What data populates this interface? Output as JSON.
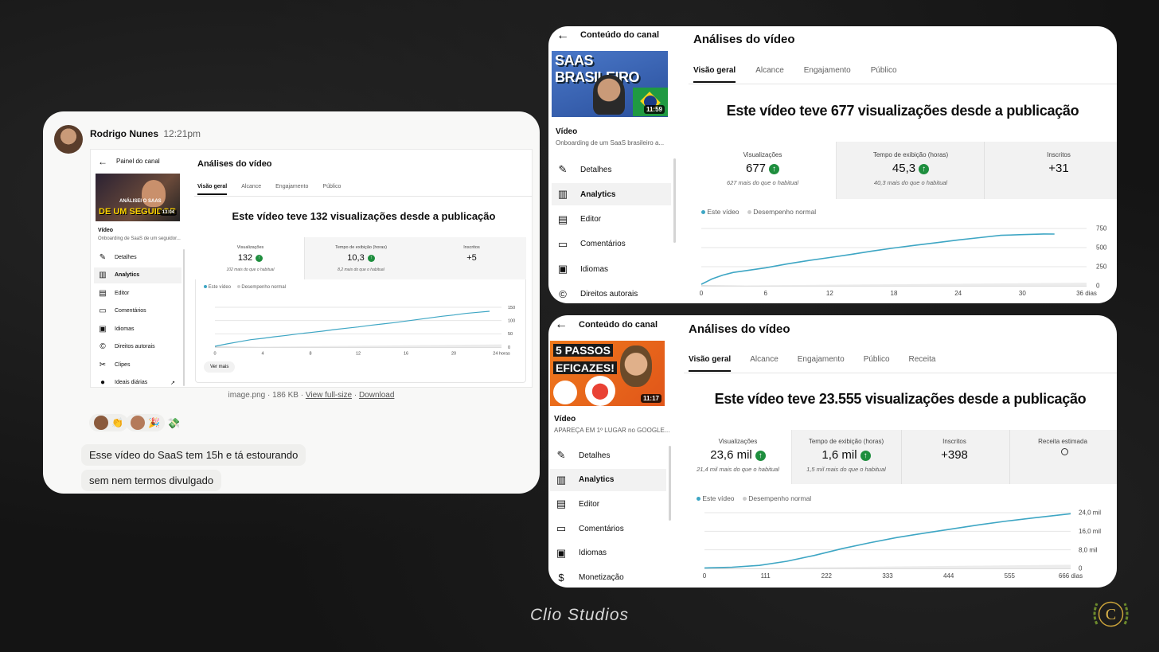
{
  "chat": {
    "author": "Rodrigo Nunes",
    "time": "12:21pm",
    "attachment": {
      "name": "image.png",
      "size": "186 KB",
      "view_label": "View full-size",
      "download_label": "Download",
      "separator": "·"
    },
    "messages": [
      "Esse vídeo do SaaS tem 15h e tá estourando",
      "sem nem termos divulgado"
    ],
    "reactions": [
      "👏",
      "🎉",
      "💸"
    ],
    "embed": {
      "back_label": "Painel do canal",
      "page_title": "Análises do vídeo",
      "tabs": [
        "Visão geral",
        "Alcance",
        "Engajamento",
        "Público"
      ],
      "thumb": {
        "text_small": "ANÁLISEI O SAAS",
        "text_big": "DE UM SEGUIDOR",
        "duration": "13:04"
      },
      "video_label": "Vídeo",
      "video_title": "Onboarding de SaaS de um seguidor...",
      "nav": [
        {
          "icon": "pencil-icon",
          "label": "Detalhes"
        },
        {
          "icon": "analytics-icon",
          "label": "Analytics"
        },
        {
          "icon": "editor-icon",
          "label": "Editor"
        },
        {
          "icon": "comments-icon",
          "label": "Comentários"
        },
        {
          "icon": "subtitles-icon",
          "label": "Idiomas"
        },
        {
          "icon": "copyright-icon",
          "label": "Direitos autorais"
        },
        {
          "icon": "scissors-icon",
          "label": "Clipes"
        },
        {
          "icon": "lightbulb-icon",
          "label": "Ideais diárias"
        }
      ],
      "headline": "Este vídeo teve 132 visualizações desde a publicação",
      "metrics": [
        {
          "label": "Visualizações",
          "value": "132",
          "up": true,
          "note": "102 mais do que o habitual"
        },
        {
          "label": "Tempo de exibição (horas)",
          "value": "10,3",
          "up": true,
          "note": "8,2 mais do que o habitual"
        },
        {
          "label": "Inscritos",
          "value": "+5",
          "up": false,
          "note": ""
        }
      ],
      "legend": [
        "Este vídeo",
        "Desempenho normal"
      ],
      "see_more": "Ver mais"
    }
  },
  "yt1": {
    "back_label": "Conteúdo do canal",
    "page_title": "Análises do vídeo",
    "tabs": [
      "Visão geral",
      "Alcance",
      "Engajamento",
      "Público"
    ],
    "thumb": {
      "text": "SAAS BRASILEIRO",
      "duration": "11:59"
    },
    "video_label": "Vídeo",
    "video_title": "Onboarding de um SaaS brasileiro a...",
    "nav": [
      {
        "icon": "pencil-icon",
        "label": "Detalhes"
      },
      {
        "icon": "analytics-icon",
        "label": "Analytics"
      },
      {
        "icon": "editor-icon",
        "label": "Editor"
      },
      {
        "icon": "comments-icon",
        "label": "Comentários"
      },
      {
        "icon": "subtitles-icon",
        "label": "Idiomas"
      },
      {
        "icon": "copyright-icon",
        "label": "Direitos autorais"
      }
    ],
    "headline": "Este vídeo teve 677 visualizações desde a publicação",
    "metrics": [
      {
        "label": "Visualizações",
        "value": "677",
        "up": true,
        "note": "627 mais do que o habitual"
      },
      {
        "label": "Tempo de exibição (horas)",
        "value": "45,3",
        "up": true,
        "note": "40,3 mais do que o habitual"
      },
      {
        "label": "Inscritos",
        "value": "+31",
        "up": false,
        "note": ""
      }
    ],
    "legend": [
      "Este vídeo",
      "Desempenho normal"
    ]
  },
  "yt2": {
    "back_label": "Conteúdo do canal",
    "page_title": "Análises do vídeo",
    "tabs": [
      "Visão geral",
      "Alcance",
      "Engajamento",
      "Público",
      "Receita"
    ],
    "thumb": {
      "text1": "5 PASSOS",
      "text2": "EFICAZES!",
      "duration": "11:17"
    },
    "video_label": "Vídeo",
    "video_title": "APAREÇA EM 1º LUGAR no GOOGLE...",
    "nav": [
      {
        "icon": "pencil-icon",
        "label": "Detalhes"
      },
      {
        "icon": "analytics-icon",
        "label": "Analytics"
      },
      {
        "icon": "editor-icon",
        "label": "Editor"
      },
      {
        "icon": "comments-icon",
        "label": "Comentários"
      },
      {
        "icon": "subtitles-icon",
        "label": "Idiomas"
      },
      {
        "icon": "dollar-icon",
        "label": "Monetização"
      }
    ],
    "headline": "Este vídeo teve 23.555 visualizações desde a publicação",
    "metrics": [
      {
        "label": "Visualizações",
        "value": "23,6 mil",
        "up": true,
        "note": "21,4 mil mais do que o habitual"
      },
      {
        "label": "Tempo de exibição (horas)",
        "value": "1,6 mil",
        "up": true,
        "note": "1,5 mil mais do que o habitual"
      },
      {
        "label": "Inscritos",
        "value": "+398",
        "up": false,
        "note": ""
      },
      {
        "label": "Receita estimada",
        "value": "",
        "up": false,
        "note": ""
      }
    ],
    "legend": [
      "Este vídeo",
      "Desempenho normal"
    ]
  },
  "footer": {
    "brand": "Clio Studios",
    "logo_letter": "C"
  },
  "colors": {
    "line": "#3ea6c4",
    "normal_band": "#ececec",
    "up": "#1e8e3e"
  },
  "chart_data": [
    {
      "type": "line",
      "xlabel": "",
      "ylabel": "",
      "x_ticks": [
        "0",
        "4",
        "8",
        "12",
        "16",
        "20",
        "24 horas"
      ],
      "y_ticks": [
        "0",
        "50",
        "100",
        "150"
      ],
      "xlim": [
        0,
        24
      ],
      "ylim": [
        0,
        150
      ],
      "series": [
        {
          "name": "Este vídeo",
          "x": [
            0,
            1,
            2,
            3,
            4,
            5,
            6,
            7,
            8,
            9,
            10,
            11,
            12,
            13,
            14,
            15,
            16,
            17,
            18,
            19,
            20,
            21,
            22,
            23
          ],
          "values": [
            3,
            12,
            20,
            28,
            33,
            39,
            44,
            50,
            55,
            60,
            66,
            71,
            76,
            82,
            87,
            92,
            98,
            104,
            110,
            116,
            121,
            127,
            131,
            135
          ]
        },
        {
          "name": "Desempenho normal",
          "x": [
            0,
            24
          ],
          "values": [
            0,
            10
          ]
        }
      ]
    },
    {
      "type": "line",
      "xlabel": "",
      "ylabel": "",
      "x_ticks": [
        "0",
        "6",
        "12",
        "18",
        "24",
        "30",
        "36 dias"
      ],
      "y_ticks": [
        "0",
        "250",
        "500",
        "750"
      ],
      "xlim": [
        0,
        36
      ],
      "ylim": [
        0,
        750
      ],
      "series": [
        {
          "name": "Este vídeo",
          "x": [
            0,
            1,
            2,
            3,
            4,
            6,
            8,
            10,
            12,
            14,
            16,
            18,
            20,
            22,
            24,
            26,
            28,
            30,
            32,
            33
          ],
          "values": [
            20,
            90,
            140,
            175,
            195,
            235,
            285,
            330,
            370,
            410,
            455,
            495,
            530,
            565,
            600,
            630,
            660,
            670,
            678,
            677
          ],
          "show_label": false
        },
        {
          "name": "Desempenho normal",
          "x": [
            0,
            36
          ],
          "values": [
            0,
            40
          ]
        }
      ]
    },
    {
      "type": "line",
      "xlabel": "",
      "ylabel": "",
      "x_ticks": [
        "0",
        "111",
        "222",
        "333",
        "444",
        "555",
        "666 dias"
      ],
      "y_ticks": [
        "0",
        "8,0 mil",
        "16,0 mil",
        "24,0 mil"
      ],
      "xlim": [
        0,
        666
      ],
      "ylim": [
        0,
        24000
      ],
      "series": [
        {
          "name": "Este vídeo",
          "x": [
            0,
            50,
            100,
            150,
            200,
            250,
            300,
            350,
            400,
            450,
            500,
            550,
            600,
            666
          ],
          "values": [
            200,
            500,
            1300,
            3100,
            5600,
            8500,
            11000,
            13300,
            15200,
            17000,
            18800,
            20400,
            21800,
            23555
          ]
        },
        {
          "name": "Desempenho normal",
          "x": [
            0,
            666
          ],
          "values": [
            0,
            1600
          ]
        }
      ]
    }
  ]
}
